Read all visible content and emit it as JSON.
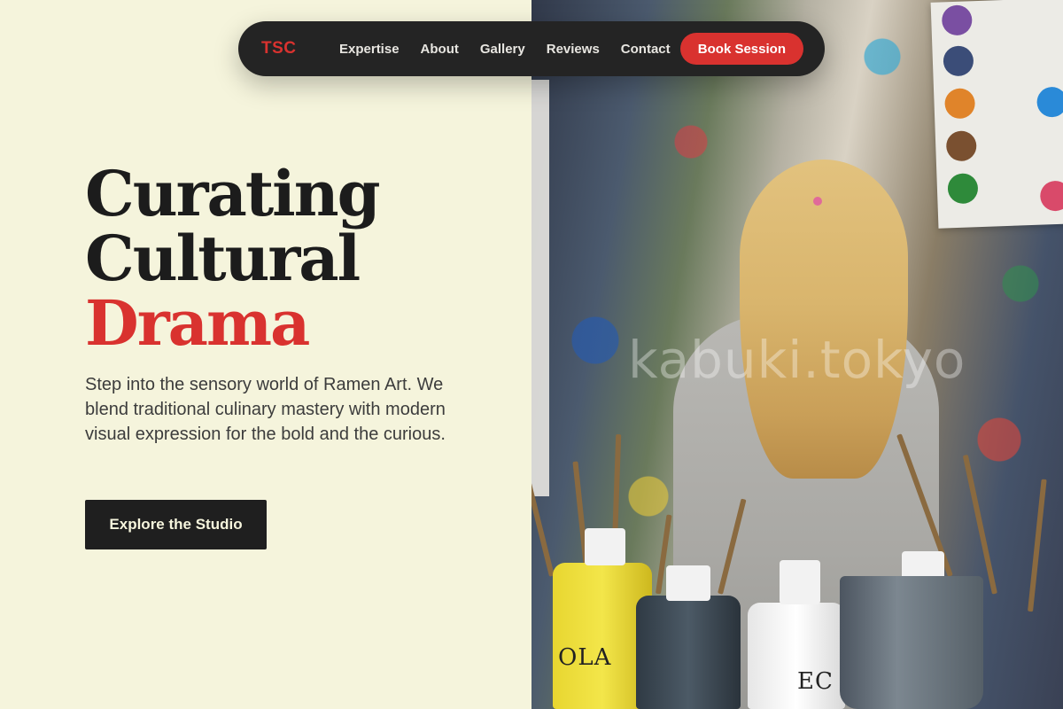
{
  "nav": {
    "logo": "TSC",
    "links": [
      "Expertise",
      "About",
      "Gallery",
      "Reviews",
      "Contact"
    ],
    "cta_label": "Book Session"
  },
  "hero": {
    "title_line1": "Curating",
    "title_line2": "Cultural",
    "title_accent": "Drama",
    "description": "Step into the sensory world of Ramen Art. We blend traditional culinary mastery with modern visual expression for the bold and the curious.",
    "button_label": "Explore the Studio"
  },
  "image": {
    "watermark": "kabuki.tokyo",
    "bottle_labels": [
      "OLA",
      "EC"
    ]
  },
  "colors": {
    "accent": "#d9322f",
    "page_background": "#f5f4dc",
    "nav_background": "#242424",
    "text_dark": "#1c1c1c"
  }
}
